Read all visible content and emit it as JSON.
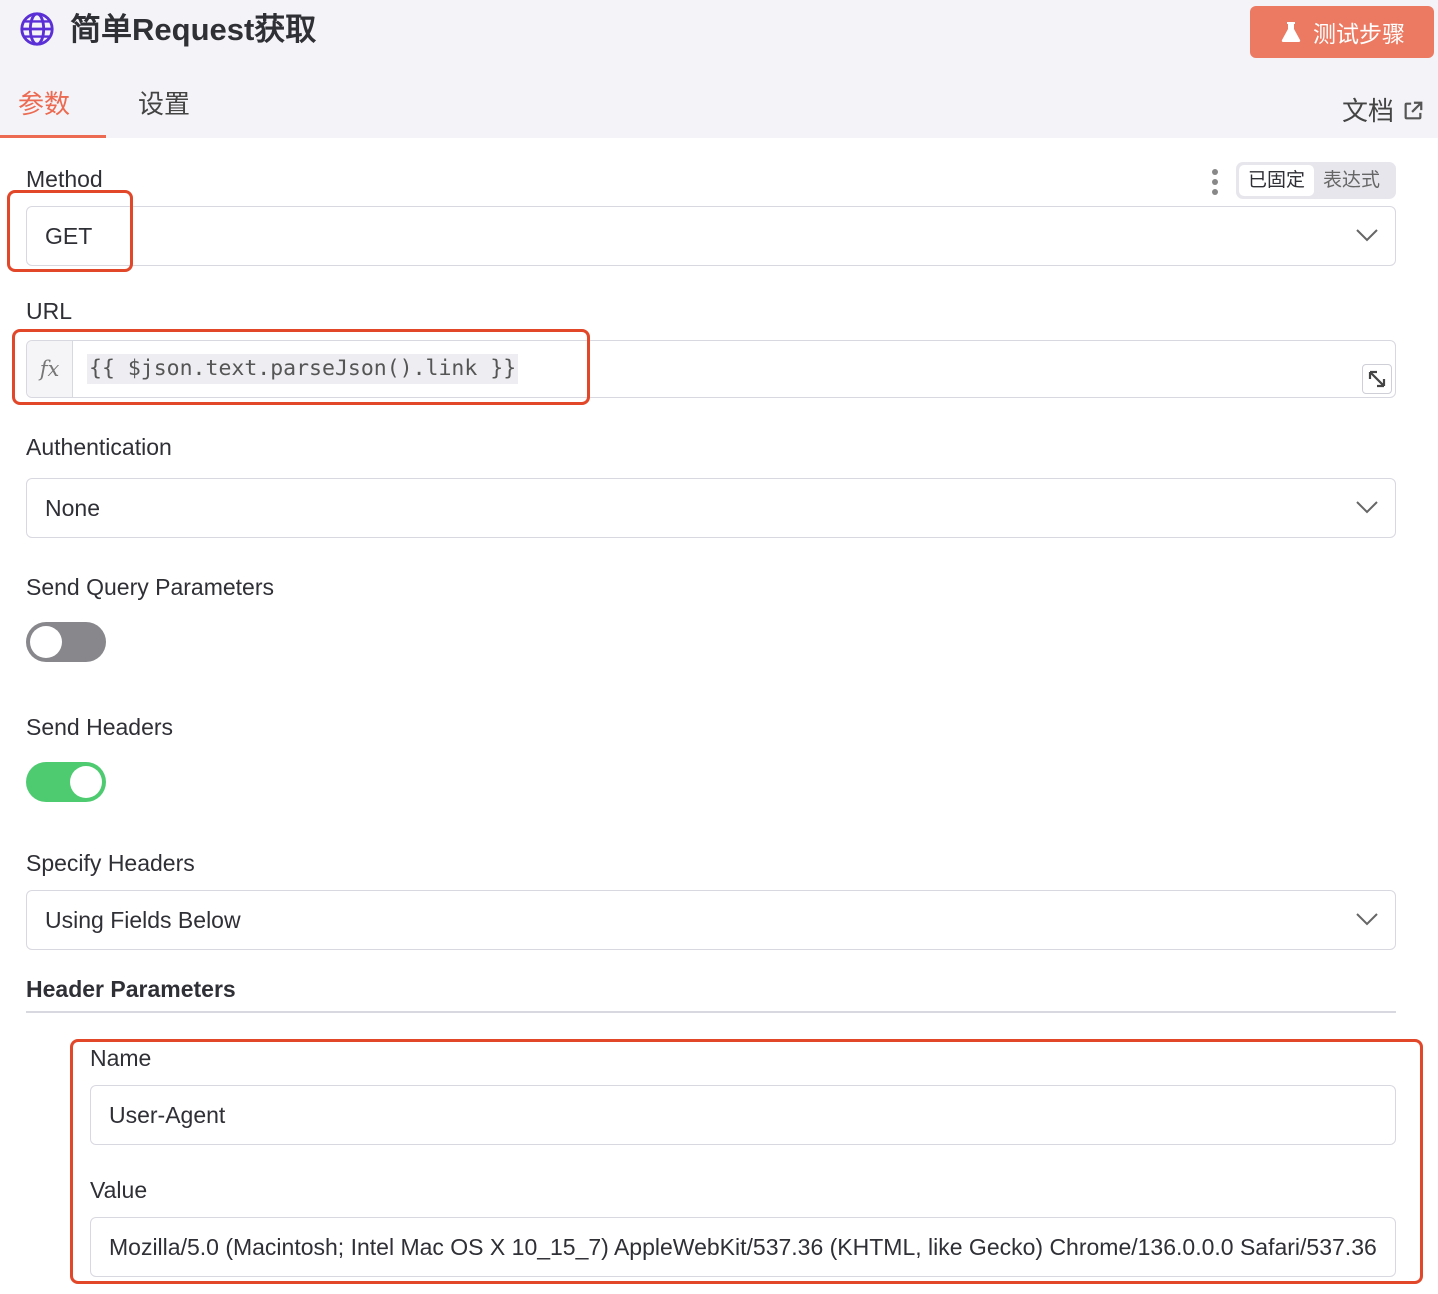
{
  "header": {
    "title": "简单Request获取",
    "title_icon": "globe-icon",
    "test_button_label": "测试步骤",
    "test_button_icon": "flask-icon",
    "accent_color": "#ec7a62"
  },
  "tabs": {
    "params": "参数",
    "settings": "设置",
    "docs": "文档",
    "active": "参数"
  },
  "method": {
    "label": "Method",
    "value": "GET",
    "mode_fixed": "已固定",
    "mode_expression": "表达式",
    "active_mode": "已固定"
  },
  "url": {
    "label": "URL",
    "fx_label": "fx",
    "expression": "{{ $json.text.parseJson().link }}"
  },
  "authentication": {
    "label": "Authentication",
    "value": "None"
  },
  "send_query": {
    "label": "Send Query Parameters",
    "enabled": false
  },
  "send_headers": {
    "label": "Send Headers",
    "enabled": true
  },
  "specify_headers": {
    "label": "Specify Headers",
    "value": "Using Fields Below"
  },
  "header_parameters": {
    "label": "Header Parameters",
    "name_label": "Name",
    "name_value": "User-Agent",
    "value_label": "Value",
    "value_value": "Mozilla/5.0 (Macintosh; Intel Mac OS X 10_15_7) AppleWebKit/537.36 (KHTML, like Gecko) Chrome/136.0.0.0 Safari/537.36"
  }
}
